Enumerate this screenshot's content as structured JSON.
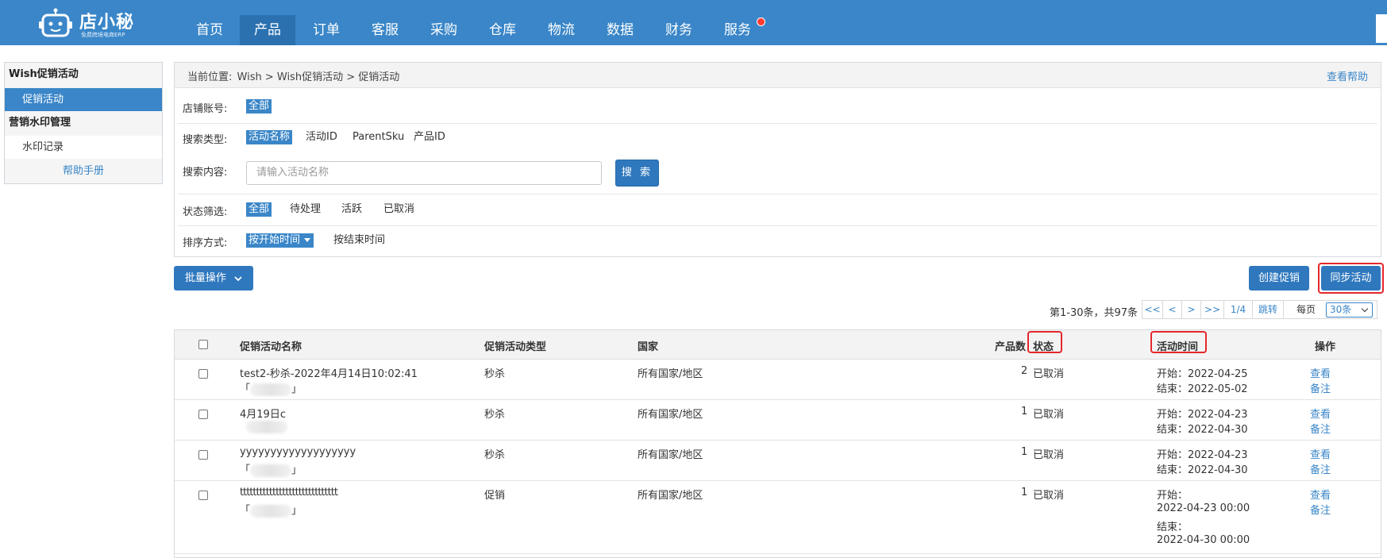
{
  "brand": {
    "name": "店小秘",
    "tagline": "免费跨境电商ERP"
  },
  "nav": [
    "首页",
    "产品",
    "订单",
    "客服",
    "采购",
    "仓库",
    "物流",
    "数据",
    "财务",
    "服务"
  ],
  "sidebar": {
    "group1": "Wish促销活动",
    "item1": "促销活动",
    "group2": "营销水印管理",
    "item2": "水印记录",
    "help": "帮助手册"
  },
  "breadcrumb": {
    "prefix": "当前位置:",
    "path": "Wish > Wish促销活动 > 促销活动",
    "help": "查看帮助"
  },
  "filters": {
    "store_label": "店铺账号:",
    "store_all": "全部",
    "search_type_label": "搜索类型:",
    "search_types": [
      "活动名称",
      "活动ID",
      "ParentSku",
      "产品ID"
    ],
    "search_content_label": "搜索内容:",
    "search_placeholder": "请输入活动名称",
    "search_button": "搜 索",
    "status_label": "状态筛选:",
    "statuses": [
      "全部",
      "待处理",
      "活跃",
      "已取消"
    ],
    "sort_label": "排序方式:",
    "sort_options": [
      "按开始时间",
      "按结束时间"
    ]
  },
  "actions": {
    "batch": "批量操作",
    "create": "创建促销",
    "sync": "同步活动"
  },
  "pager": {
    "summary": "第1-30条，共97条",
    "first": "<<",
    "prev": "<",
    "next": ">",
    "last": ">>",
    "page": "1/4",
    "jump": "跳转",
    "per_page_label": "每页",
    "per_page": "30条"
  },
  "table": {
    "headers": {
      "name": "促销活动名称",
      "type": "促销活动类型",
      "country": "国家",
      "count": "产品数",
      "status": "状态",
      "time": "活动时间",
      "ops": "操作"
    },
    "rows": [
      {
        "name": "test2-秒杀-2022年4月14日10:02:41",
        "type": "秒杀",
        "country": "所有国家/地区",
        "count": "2",
        "status": "已取消",
        "start": "开始：2022-04-25",
        "end": "结束：2022-05-02",
        "view": "查看",
        "note": "备注"
      },
      {
        "name": "4月19日c",
        "type": "秒杀",
        "country": "所有国家/地区",
        "count": "1",
        "status": "已取消",
        "start": "开始：2022-04-23",
        "end": "结束：2022-04-30",
        "view": "查看",
        "note": "备注"
      },
      {
        "name": "yyyyyyyyyyyyyyyyyyy",
        "type": "秒杀",
        "country": "所有国家/地区",
        "count": "1",
        "status": "已取消",
        "start": "开始：2022-04-23",
        "end": "结束：2022-04-30",
        "view": "查看",
        "note": "备注"
      },
      {
        "name": "tttttttttttttttttttttttttttttt",
        "type": "促销",
        "country": "所有国家/地区",
        "count": "1",
        "status": "已取消",
        "start_label": "开始：",
        "start_value": "2022-04-23 00:00",
        "end_label": "结束：",
        "end_value": "2022-04-30 00:00",
        "view": "查看",
        "note": "备注"
      }
    ],
    "store_bracket_open": "「",
    "store_bracket_close": "」"
  },
  "colors": {
    "primary": "#3a86c8",
    "button": "#2f78be",
    "highlight": "#e5282c",
    "badge": "#ff3b30"
  }
}
